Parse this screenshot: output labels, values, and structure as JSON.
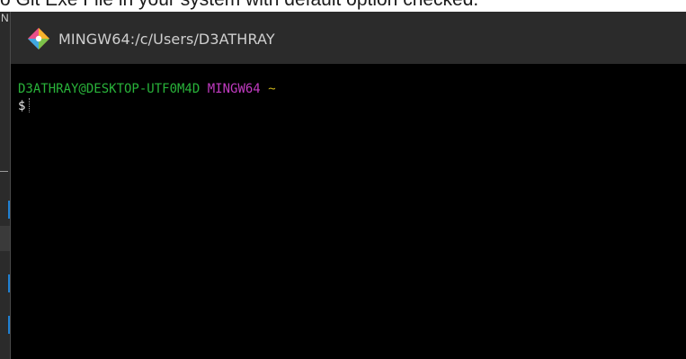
{
  "caption": {
    "text": "o Git Exe File in your system with default option checked."
  },
  "window": {
    "title": "MINGW64:/c/Users/D3ATHRAY",
    "icon": "git-diamond-icon"
  },
  "terminal": {
    "user_host": "D3ATHRAY@DESKTOP-UTF0M4D",
    "shell": "MINGW64",
    "cwd": "~",
    "prompt_symbol": "$",
    "colors": {
      "background": "#000000",
      "user_host": "#29b33a",
      "shell": "#c23bc2",
      "cwd": "#c7b11a",
      "text": "#e8e8e8"
    }
  },
  "background_window": {
    "corner_glyph": "N"
  }
}
